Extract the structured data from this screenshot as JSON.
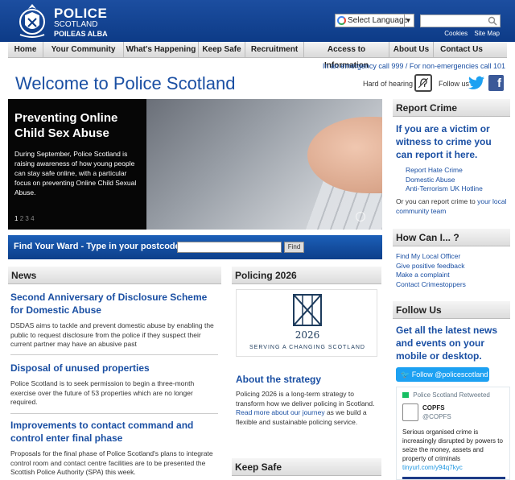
{
  "header": {
    "brand_line1": "POLICE",
    "brand_line2": "SCOTLAND",
    "brand_line3": "POILEAS ALBA",
    "language_label": "Select Language",
    "search_placeholder": "",
    "top_links": [
      "Cookies",
      "Site Map"
    ]
  },
  "nav": {
    "items": [
      "Home",
      "Your Community",
      "What's Happening",
      "Keep Safe",
      "Recruitment",
      "Access to Information",
      "About Us",
      "Contact Us"
    ]
  },
  "emergency_text": "In an emergency call 999 / For non-emergencies call 101",
  "page_title": "Welcome to Police Scotland",
  "accessibility": {
    "hard_of_hearing": "Hard of hearing",
    "follow_us": "Follow us"
  },
  "hero": {
    "title": "Preventing Online Child Sex Abuse",
    "text": "During September, Police Scotland is raising awareness of how young people can stay safe online, with a particular focus on preventing Online Child Sexual Abuse.",
    "slides": [
      "1",
      "2",
      "3",
      "4"
    ]
  },
  "ward": {
    "label": "Find Your Ward - Type in your postcode:",
    "button": "Find"
  },
  "news": {
    "heading": "News",
    "items": [
      {
        "title": "Second Anniversary of Disclosure Scheme for Domestic Abuse",
        "body": "DSDAS aims to tackle and prevent domestic abuse by enabling the public to request disclosure from the police if they suspect their current partner may have an abusive past"
      },
      {
        "title": "Disposal of unused properties",
        "body": "Police Scotland is to seek permission to begin a three-month exercise over the future of 53 properties which are no longer required."
      },
      {
        "title": "Improvements to contact command and control enter final phase",
        "body": "Proposals for the final phase of Police Scotland's plans to integrate control room and contact centre facilities are to be presented the Scottish Police Authority (SPA) this week."
      }
    ]
  },
  "policing2026": {
    "heading": "Policing 2026",
    "logo_year": "2026",
    "logo_tagline": "SERVING A CHANGING SCOTLAND",
    "about_title": "About the strategy",
    "about_text_before": "Policing 2026 is a long-term strategy to transform how we deliver policing in Scotland.",
    "about_link": "Read more about our journey",
    "about_text_after": "as we build a flexible and sustainable policing service."
  },
  "keep_safe": {
    "heading": "Keep Safe"
  },
  "report_crime": {
    "heading": "Report Crime",
    "lead": "If you are a victim or witness to crime you can report it here.",
    "links": [
      "Report Hate Crime",
      "Domestic Abuse",
      "Anti-Terrorism UK Hotline"
    ],
    "note_before": "Or you can report crime to",
    "note_link": "your local community team"
  },
  "how_can_i": {
    "heading": "How Can I... ?",
    "links": [
      "Find My Local Officer",
      "Give positive feedback",
      "Make a complaint",
      "Contact Crimestoppers"
    ]
  },
  "follow_us": {
    "heading": "Follow Us",
    "lead": "Get all the latest news and events on your mobile or desktop.",
    "twitter_button": "Follow @policescotland",
    "retweeted": "Police Scotland Retweeted",
    "author_name": "COPFS",
    "author_handle": "@COPFS",
    "tweet_text": "Serious organised crime is increasingly disrupted by powers to seize the money, assets and property of criminals",
    "tweet_link": "tinyurl.com/y94q7kyc"
  },
  "colors": {
    "brand_blue": "#1a4fa3",
    "header_blue": "#0d3b87",
    "twitter_blue": "#1da1f2",
    "facebook_blue": "#3b5998"
  }
}
